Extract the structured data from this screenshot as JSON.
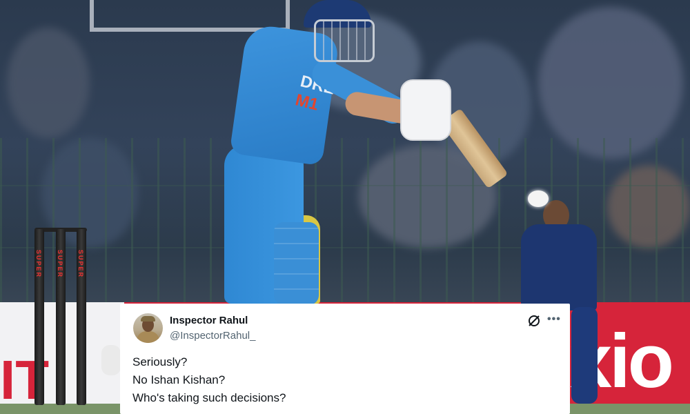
{
  "tweet": {
    "display_name": "Inspector Rahul",
    "handle": "@InspectorRahul_",
    "lines": [
      "Seriously?",
      "No Ishan Kishan?",
      "Who's taking such decisions?"
    ],
    "icons": {
      "grok": "grok-icon",
      "more": "more-options-icon",
      "avatar": "avatar"
    }
  },
  "photo": {
    "board_text_right": "xio",
    "board_text_left": "IT",
    "jersey_text_top": "DRE",
    "jersey_text_bottom": "M1",
    "stump_text": "SUPER",
    "colors": {
      "jersey": "#2f88d3",
      "board": "#d6243a",
      "fielder": "#1d3670"
    }
  }
}
